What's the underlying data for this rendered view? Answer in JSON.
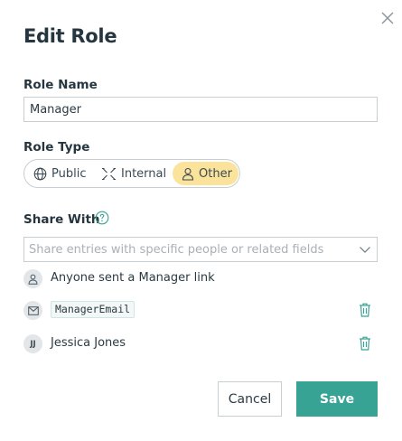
{
  "dialog": {
    "title": "Edit Role",
    "close_icon": "close-icon"
  },
  "role_name": {
    "label": "Role Name",
    "value": "Manager"
  },
  "role_type": {
    "label": "Role Type",
    "options": [
      {
        "label": "Public",
        "icon": "globe-icon"
      },
      {
        "label": "Internal",
        "icon": "internal-icon"
      },
      {
        "label": "Other",
        "icon": "person-icon"
      }
    ],
    "selected": "Other",
    "selected_color": "#fbe39c"
  },
  "share_with": {
    "label": "Share With",
    "help_icon": "help-icon",
    "placeholder": "Share entries with specific people or related fields",
    "entries": [
      {
        "icon": "person-icon",
        "text": "Anyone sent a Manager link",
        "removable": false
      },
      {
        "icon": "envelope-icon",
        "text": "ManagerEmail",
        "removable": true
      },
      {
        "initials": "JJ",
        "text": "Jessica Jones",
        "removable": true
      }
    ]
  },
  "actions": {
    "cancel_label": "Cancel",
    "save_label": "Save",
    "save_color": "#36a394",
    "icon_accent": "#36a394"
  }
}
